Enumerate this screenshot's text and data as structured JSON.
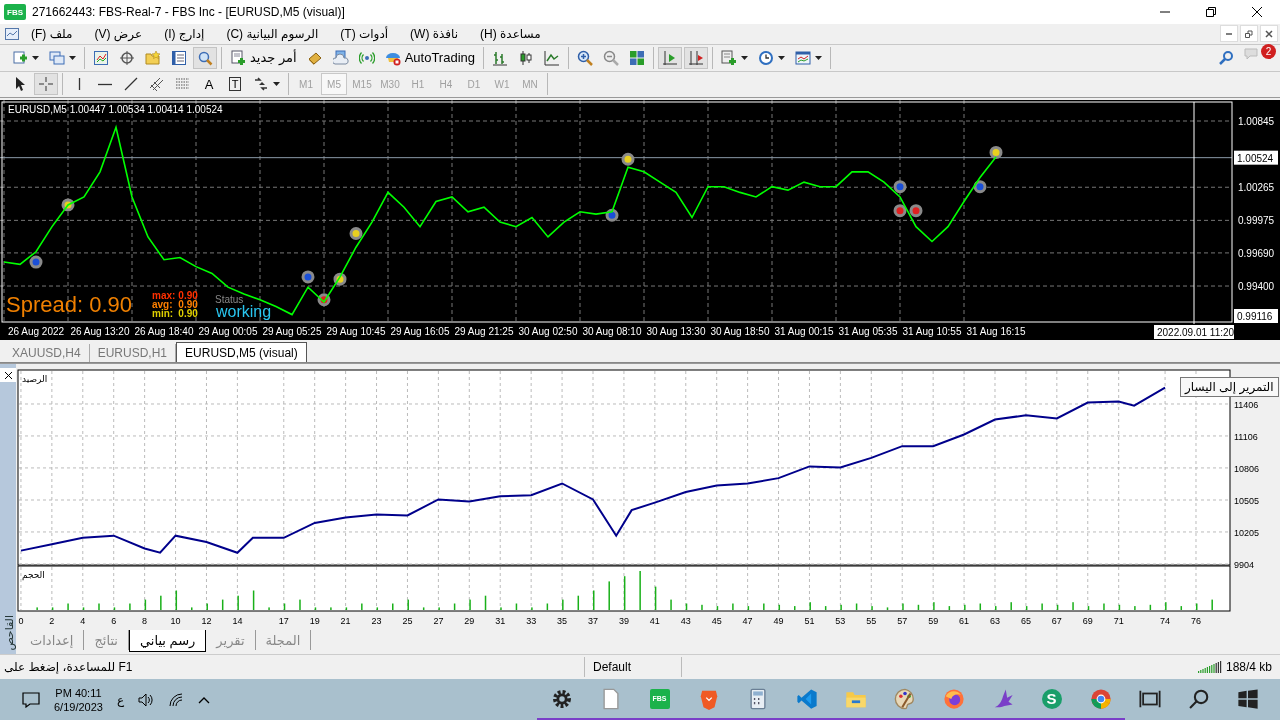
{
  "window": {
    "title": "271662443: FBS-Real-7 - FBS Inc - [EURUSD,M5 (visual)]",
    "logo": "FBS"
  },
  "menu": [
    "مساعدة (H)",
    "نافذة (W)",
    "أدوات (T)",
    "الرسوم البيانية (C)",
    "إدارج (I)",
    "عرض (V)",
    "ملف (F)"
  ],
  "toolbar": {
    "groups": [
      {
        "items": [
          {
            "kind": "new-chart",
            "pressed": false,
            "dropdown": true
          },
          {
            "kind": "profiles",
            "pressed": false,
            "dropdown": true
          }
        ]
      },
      {
        "items": [
          {
            "kind": "market-watch",
            "pressed": false,
            "dropdown": false
          },
          {
            "kind": "navigator",
            "pressed": false,
            "dropdown": false
          },
          {
            "kind": "favorites",
            "pressed": false,
            "dropdown": false
          },
          {
            "kind": "terminal",
            "pressed": false,
            "dropdown": false
          },
          {
            "kind": "tester",
            "pressed": true,
            "dropdown": false
          }
        ]
      },
      {
        "items": [
          {
            "kind": "new-order",
            "label": "أمر جديد",
            "pressed": false,
            "dropdown": false
          },
          {
            "kind": "metaeditor",
            "pressed": false,
            "dropdown": false
          },
          {
            "kind": "market",
            "pressed": false,
            "dropdown": false
          },
          {
            "kind": "signals",
            "pressed": false,
            "dropdown": false
          },
          {
            "kind": "autotrading",
            "label": "AutoTrading",
            "pressed": false,
            "dropdown": false
          }
        ]
      },
      {
        "items": [
          {
            "kind": "bars",
            "pressed": false,
            "dropdown": false
          },
          {
            "kind": "candles",
            "pressed": false,
            "dropdown": false
          },
          {
            "kind": "line",
            "pressed": false,
            "dropdown": false
          }
        ]
      },
      {
        "items": [
          {
            "kind": "zoom-in",
            "pressed": false,
            "dropdown": false
          },
          {
            "kind": "zoom-out",
            "pressed": false,
            "dropdown": false
          },
          {
            "kind": "tile",
            "pressed": false,
            "dropdown": false
          }
        ]
      },
      {
        "items": [
          {
            "kind": "autoscroll",
            "pressed": true,
            "dropdown": false
          },
          {
            "kind": "shift",
            "pressed": true,
            "dropdown": false
          }
        ]
      },
      {
        "items": [
          {
            "kind": "indicators",
            "pressed": false,
            "dropdown": true
          },
          {
            "kind": "periods",
            "pressed": false,
            "dropdown": true
          },
          {
            "kind": "templates",
            "pressed": false,
            "dropdown": true
          }
        ]
      }
    ],
    "notifications": "2"
  },
  "drawing_toolbar": {
    "groups": [
      {
        "items": [
          {
            "kind": "cursor",
            "pressed": false,
            "dropdown": false
          },
          {
            "kind": "crosshair",
            "pressed": true,
            "dropdown": false
          }
        ]
      },
      {
        "items": [
          {
            "kind": "vline",
            "pressed": false,
            "dropdown": false
          },
          {
            "kind": "hline",
            "pressed": false,
            "dropdown": false
          },
          {
            "kind": "trend",
            "pressed": false,
            "dropdown": false
          },
          {
            "kind": "channel",
            "pressed": false,
            "dropdown": false
          },
          {
            "kind": "fibo",
            "pressed": false,
            "dropdown": false
          },
          {
            "kind": "text",
            "label": "A",
            "pressed": false,
            "dropdown": false
          },
          {
            "kind": "label",
            "label": "T",
            "pressed": false,
            "dropdown": false
          },
          {
            "kind": "arrows",
            "pressed": false,
            "dropdown": true
          }
        ]
      }
    ],
    "timeframes": [
      {
        "label": "M1",
        "selected": false
      },
      {
        "label": "M5",
        "selected": true
      },
      {
        "label": "M15",
        "selected": false
      },
      {
        "label": "M30",
        "selected": false
      },
      {
        "label": "H1",
        "selected": false
      },
      {
        "label": "H4",
        "selected": false
      },
      {
        "label": "D1",
        "selected": false
      },
      {
        "label": "W1",
        "selected": false
      },
      {
        "label": "MN",
        "selected": false
      }
    ]
  },
  "chart": {
    "header": "EURUSD,M5  1.00447 1.00534 1.00414 1.00524",
    "cursor_price": "0.99116",
    "cursor_time": "2022.09.01 11:20",
    "spread": "Spread: 0.90",
    "stats": [
      {
        "label": "max:",
        "value": "0.90",
        "color": "#ff3000"
      },
      {
        "label": "avg:",
        "value": "0.90",
        "color": "#ff8000"
      },
      {
        "label": "min:",
        "value": "0.90",
        "color": "#e0d000"
      }
    ],
    "status_label": "Status",
    "status": "working",
    "chart_data": {
      "type": "line",
      "grid": true,
      "ylim": [
        0.99085,
        1.01029
      ],
      "ref_lines": [
        {
          "axis": "y",
          "value": 1.00524,
          "label": "1.00524"
        }
      ],
      "categories": [
        null,
        null,
        "26 Aug 2022",
        null,
        null,
        null,
        "26 Aug 13:20",
        null,
        null,
        null,
        "26 Aug 18:40",
        null,
        null,
        null,
        "29 Aug 00:05",
        null,
        null,
        null,
        "29 Aug 05:25",
        null,
        null,
        null,
        "29 Aug 10:45",
        null,
        null,
        null,
        "29 Aug 16:05",
        null,
        null,
        null,
        "29 Aug 21:25",
        null,
        null,
        null,
        "30 Aug 02:50",
        null,
        null,
        null,
        "30 Aug 08:10",
        null,
        null,
        null,
        "30 Aug 13:30",
        null,
        null,
        null,
        "30 Aug 18:50",
        null,
        null,
        null,
        "31 Aug 00:15",
        null,
        null,
        null,
        "31 Aug 05:35",
        null,
        null,
        null,
        "31 Aug 10:55",
        null,
        null,
        null,
        "31 Aug 16:15"
      ],
      "yticks": [
        {
          "value": 1.00845,
          "label": "1.00845"
        },
        {
          "value": 1.00265,
          "label": "1.00265"
        },
        {
          "value": 0.99975,
          "label": "0.99975"
        },
        {
          "value": 0.9969,
          "label": "0.99690"
        },
        {
          "value": 0.994,
          "label": "0.99400"
        }
      ],
      "series": [
        {
          "color": "#00ff00",
          "values": [
            0.9961,
            0.9959,
            0.997,
            0.9992,
            1.0011,
            1.0018,
            1.004,
            1.0079,
            1.0018,
            0.9983,
            0.9963,
            0.9965,
            0.9957,
            0.9951,
            0.9939,
            0.9933,
            0.9928,
            0.9922,
            0.9915,
            0.9939,
            0.9926,
            0.9948,
            0.9974,
            0.9996,
            1.0022,
            1.0009,
            0.9992,
            1.0014,
            1.0018,
            1.0005,
            1.0009,
            0.9996,
            0.9992,
            1.0,
            0.9983,
            0.9996,
            1.0005,
            1.0003,
            1.0005,
            1.0044,
            1.004,
            1.0031,
            1.0022,
            1.0,
            1.0027,
            1.0027,
            1.0022,
            1.0018,
            1.0027,
            1.0024,
            1.0031,
            1.0027,
            1.0027,
            1.004,
            1.004,
            1.0031,
            1.0018,
            0.9992,
            0.9979,
            0.9992,
            1.0014,
            1.0035,
            1.0053
          ]
        },
        {
          "type": "scatter",
          "color": "#1a4fd8",
          "values": [
            null,
            null,
            0.9961,
            null,
            null,
            null,
            null,
            null,
            null,
            null,
            null,
            null,
            null,
            null,
            null,
            null,
            null,
            null,
            null,
            0.9948,
            null,
            null,
            null,
            null,
            null,
            null,
            null,
            null,
            null,
            null,
            null,
            null,
            null,
            null,
            null,
            null,
            null,
            null,
            1.0002,
            null,
            null,
            null,
            null,
            null,
            null,
            null,
            null,
            null,
            null,
            null,
            null,
            null,
            null,
            null,
            null,
            null,
            1.0027,
            null,
            null,
            null,
            null,
            1.0027,
            null
          ]
        },
        {
          "type": "scatter",
          "color": "#e02020",
          "values": [
            null,
            null,
            null,
            null,
            null,
            null,
            null,
            null,
            null,
            null,
            null,
            null,
            null,
            null,
            null,
            null,
            null,
            null,
            null,
            null,
            0.9928,
            null,
            null,
            null,
            null,
            null,
            null,
            null,
            null,
            null,
            null,
            null,
            null,
            null,
            null,
            null,
            null,
            null,
            null,
            null,
            null,
            null,
            null,
            null,
            null,
            null,
            null,
            null,
            null,
            null,
            null,
            null,
            null,
            null,
            null,
            null,
            1.0006,
            1.0006,
            null,
            null,
            null,
            null,
            null
          ]
        },
        {
          "type": "scatter",
          "color": "#e8d020",
          "values": [
            null,
            null,
            null,
            null,
            1.0011,
            null,
            null,
            null,
            null,
            null,
            null,
            null,
            null,
            null,
            null,
            null,
            null,
            null,
            null,
            null,
            null,
            0.9946,
            0.9986,
            null,
            null,
            null,
            null,
            null,
            null,
            null,
            null,
            null,
            null,
            null,
            null,
            null,
            null,
            null,
            null,
            1.0051,
            null,
            null,
            null,
            null,
            null,
            null,
            null,
            null,
            null,
            null,
            null,
            null,
            null,
            null,
            null,
            null,
            null,
            null,
            null,
            null,
            null,
            null,
            1.0057
          ]
        }
      ]
    }
  },
  "chart_tabs": [
    {
      "label": "XAUUSD,H4",
      "selected": false
    },
    {
      "label": "EURUSD,H1",
      "selected": false
    },
    {
      "label": "EURUSD,M5 (visual)",
      "selected": true
    }
  ],
  "tester": {
    "side_label": "القاحص",
    "volume_label": "الحجم",
    "tooltip": "التمرير إلى اليسار",
    "chart_data": {
      "type": "line",
      "grid": true,
      "xlim": [
        -0.19,
        78.2
      ],
      "ylim": [
        9895,
        11725
      ],
      "yticks": [
        9904,
        10205,
        10505,
        10806,
        11106,
        11406
      ],
      "xticks": [
        0,
        2,
        4,
        6,
        8,
        10,
        12,
        14,
        17,
        19,
        21,
        23,
        25,
        27,
        29,
        31,
        33,
        35,
        37,
        39,
        41,
        43,
        45,
        47,
        49,
        51,
        53,
        55,
        57,
        59,
        61,
        63,
        65,
        67,
        69,
        71,
        74,
        76
      ],
      "x": [
        0,
        2,
        4,
        6,
        8,
        9,
        10,
        12,
        14,
        15,
        17,
        19,
        21,
        23,
        25,
        27,
        29,
        31,
        33,
        35,
        37,
        38.5,
        39.5,
        41,
        43,
        45,
        47,
        49,
        51,
        53,
        55,
        57,
        59,
        61,
        63,
        65,
        67,
        69,
        71,
        72,
        74
      ],
      "series": [
        {
          "name": "الرصيد",
          "color": "#00008b",
          "values": [
            10030,
            10090,
            10150,
            10170,
            10050,
            10010,
            10170,
            10110,
            10010,
            10150,
            10150,
            10290,
            10340,
            10370,
            10360,
            10510,
            10490,
            10540,
            10550,
            10660,
            10510,
            10170,
            10410,
            10480,
            10580,
            10640,
            10660,
            10710,
            10820,
            10810,
            10900,
            11010,
            11010,
            11120,
            11260,
            11300,
            11270,
            11420,
            11430,
            11390,
            11560
          ]
        }
      ]
    }
  },
  "tester_tabs": [
    {
      "label": "المجلة",
      "selected": false
    },
    {
      "label": "تقرير",
      "selected": false
    },
    {
      "label": "رسم بياني",
      "selected": true
    },
    {
      "label": "نتائج",
      "selected": false
    },
    {
      "label": "إعدادات",
      "selected": false
    }
  ],
  "status_bar": {
    "help": "F1 للمساعدة، إضغط على",
    "profile": "Default",
    "traffic": "188/4 kb"
  },
  "taskbar": {
    "time": "PM 40:11",
    "date": "6/19/2023",
    "language": "ع",
    "apps": [
      {
        "kind": "settings",
        "running": true
      },
      {
        "kind": "file",
        "running": true
      },
      {
        "kind": "fbs",
        "label": "FBS",
        "running": true
      },
      {
        "kind": "brave",
        "running": true
      },
      {
        "kind": "calculator",
        "running": true
      },
      {
        "kind": "vscode",
        "running": true
      },
      {
        "kind": "folder",
        "running": true
      },
      {
        "kind": "paint",
        "running": true
      },
      {
        "kind": "firefox",
        "running": true
      },
      {
        "kind": "feather",
        "running": true
      },
      {
        "kind": "s-app",
        "label": "S",
        "running": true
      },
      {
        "kind": "chrome",
        "running": true
      },
      {
        "kind": "taskview",
        "running": false
      },
      {
        "kind": "search",
        "running": false
      },
      {
        "kind": "windows",
        "running": false
      }
    ]
  }
}
